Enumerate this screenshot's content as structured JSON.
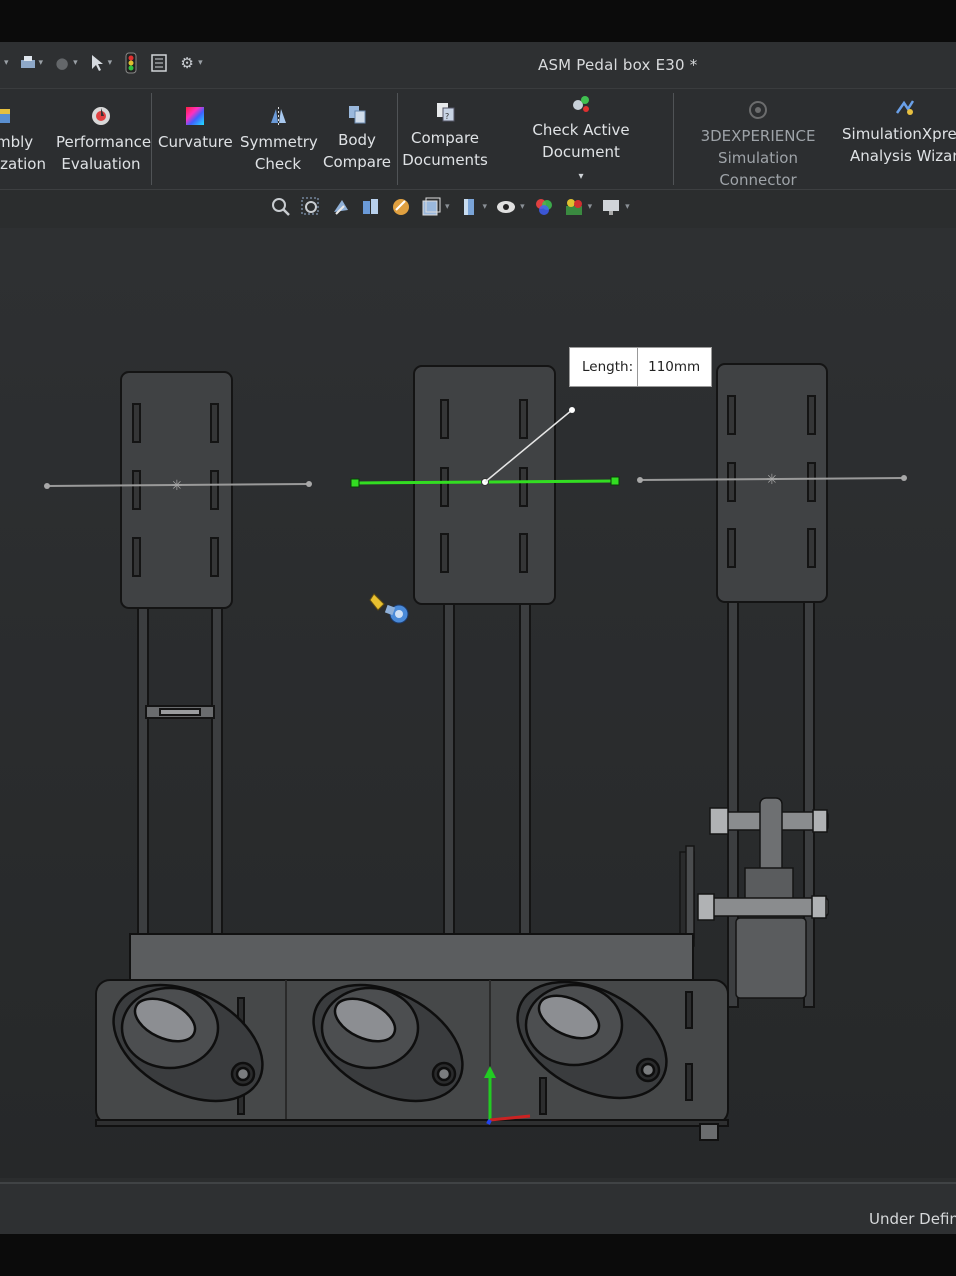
{
  "window": {
    "title": "ASM Pedal box E30 *"
  },
  "ribbon": {
    "items": [
      {
        "line1": "mbly",
        "line2": "ization"
      },
      {
        "line1": "Performance",
        "line2": "Evaluation"
      },
      {
        "line1": "Curvature",
        "line2": ""
      },
      {
        "line1": "Symmetry",
        "line2": "Check"
      },
      {
        "line1": "Body",
        "line2": "Compare"
      },
      {
        "line1": "Compare",
        "line2": "Documents"
      },
      {
        "line1": "Check Active Document",
        "line2": ""
      },
      {
        "line1": "3DEXPERIENCE",
        "line2": "Simulation Connector"
      },
      {
        "line1": "SimulationXpres",
        "line2": "Analysis Wizard"
      }
    ]
  },
  "dimension": {
    "label": "Length:",
    "value": "110mm"
  },
  "status": {
    "text": "Under Defin"
  },
  "colors": {
    "selected_line": "#33dd22",
    "axis_line": "#9a9a9a",
    "background": "#2b2d2e"
  }
}
